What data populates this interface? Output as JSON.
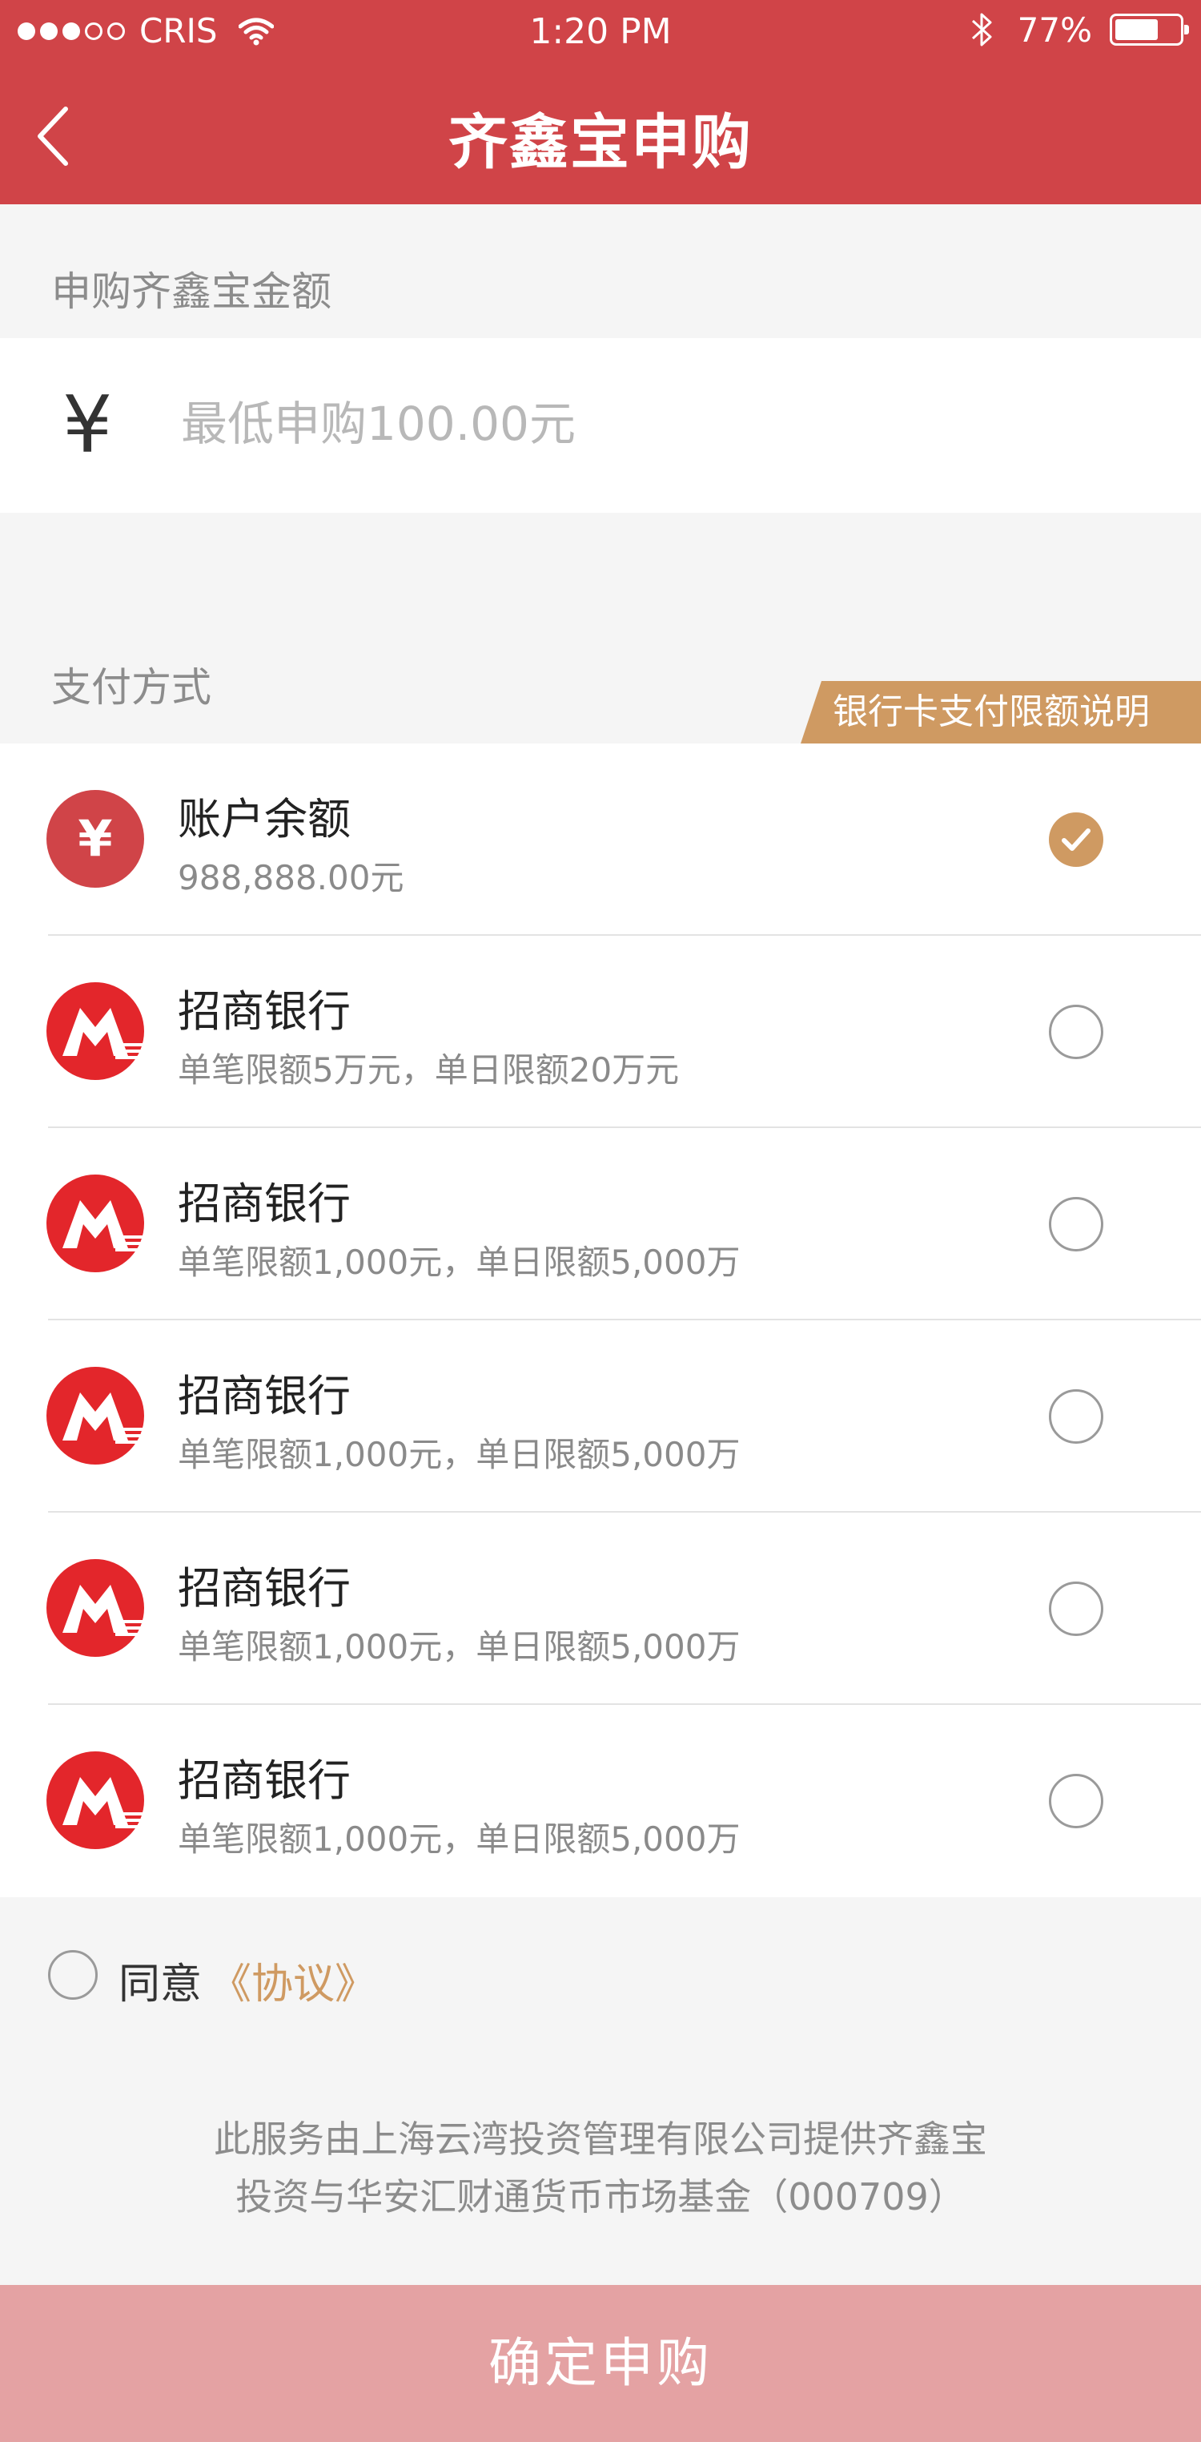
{
  "status_bar": {
    "carrier": "CRIS",
    "time": "1:20 PM",
    "battery": "77%"
  },
  "header": {
    "title": "齐鑫宝申购"
  },
  "amount_section": {
    "label": "申购齐鑫宝金额",
    "currency_symbol": "¥",
    "placeholder": "最低申购100.00元",
    "value": ""
  },
  "payment": {
    "label": "支付方式",
    "limit_tag": "银行卡支付限额说明",
    "items": [
      {
        "name": "账户余额",
        "desc": "988,888.00元",
        "icon": "yen-icon",
        "selected": true
      },
      {
        "name": "招商银行",
        "desc": "单笔限额5万元，单日限额20万元",
        "icon": "cmb-bank-logo-icon",
        "selected": false
      },
      {
        "name": "招商银行",
        "desc": "单笔限额1,000元，单日限额5,000万",
        "icon": "cmb-bank-logo-icon",
        "selected": false
      },
      {
        "name": "招商银行",
        "desc": "单笔限额1,000元，单日限额5,000万",
        "icon": "cmb-bank-logo-icon",
        "selected": false
      },
      {
        "name": "招商银行",
        "desc": "单笔限额1,000元，单日限额5,000万",
        "icon": "cmb-bank-logo-icon",
        "selected": false
      },
      {
        "name": "招商银行",
        "desc": "单笔限额1,000元，单日限额5,000万",
        "icon": "cmb-bank-logo-icon",
        "selected": false
      }
    ]
  },
  "agreement": {
    "label": "同意",
    "link": "《协议》"
  },
  "note": {
    "line1": "此服务由上海云湾投资管理有限公司提供齐鑫宝",
    "line2": "投资与华安汇财通货币市场基金（000709）"
  },
  "confirm_button": "确定申购",
  "colors": {
    "brand_red": "#d04448",
    "accent_gold": "#cf9a62",
    "button_disabled": "#e4a2a3"
  }
}
